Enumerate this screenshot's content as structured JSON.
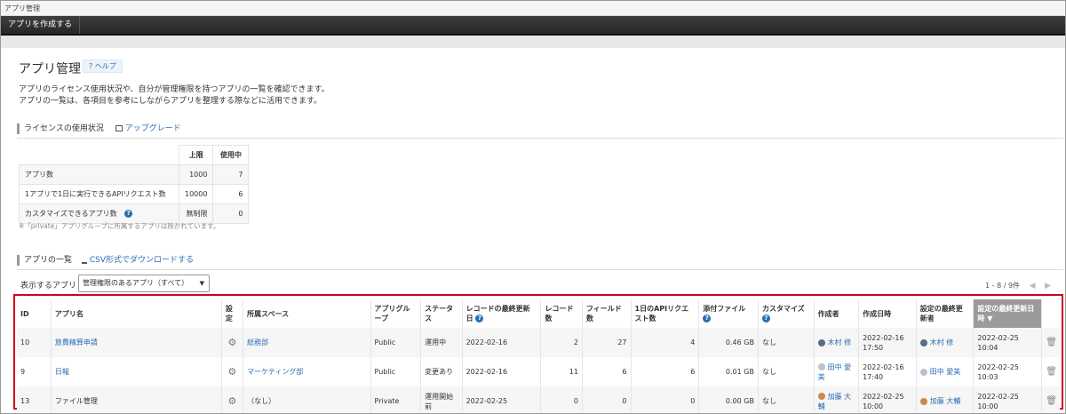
{
  "window": {
    "title": "アプリ管理"
  },
  "toolbar": {
    "create_label": "アプリを作成する"
  },
  "page": {
    "title": "アプリ管理",
    "help_label": "? ヘルプ",
    "desc_line1": "アプリのライセンス使用状況や、自分が管理権限を持つアプリの一覧を確認できます。",
    "desc_line2": "アプリの一覧は、各項目を参考にしながらアプリを整理する際などに活用できます。"
  },
  "license": {
    "heading": "ライセンスの使用状況",
    "upgrade_label": "アップグレード",
    "col_limit": "上限",
    "col_used": "使用中",
    "rows": [
      {
        "label": "アプリ数",
        "limit": "1000",
        "used": "7"
      },
      {
        "label": "1アプリで1日に実行できるAPIリクエスト数",
        "limit": "10000",
        "used": "6"
      },
      {
        "label": "カスタマイズできるアプリ数",
        "limit": "無制限",
        "used": "0"
      }
    ],
    "note": "※「private」アプリグループに所属するアプリは除かれています。"
  },
  "apps": {
    "heading": "アプリの一覧",
    "csv_label": "CSV形式でダウンロードする",
    "filter_label": "表示するアプリ",
    "filter_value": "管理権限のあるアプリ（すべて）",
    "paging": "1 - 8 / 9件",
    "columns": {
      "id": "ID",
      "name": "アプリ名",
      "settings": "設定",
      "space": "所属スペース",
      "group": "アプリグループ",
      "status": "ステータス",
      "last_record": "レコードの最終更新日",
      "records": "レコード数",
      "fields": "フィールド数",
      "api": "1日のAPIリクエスト数",
      "files": "添付ファイル",
      "custom": "カスタマイズ",
      "creator": "作成者",
      "created": "作成日時",
      "last_modifier": "設定の最終更新者",
      "last_modified": "設定の最終更新日時 ▼"
    },
    "rows": [
      {
        "id": "10",
        "name": "旅費精算申請",
        "space": "総務部",
        "group": "Public",
        "status": "運用中",
        "last_record": "2022-02-16",
        "records": "2",
        "fields": "27",
        "api": "4",
        "files": "0.46 GB",
        "custom": "なし",
        "creator": "木村 修",
        "created": "2022-02-16 17:50",
        "modifier": "木村 修",
        "modified": "2022-02-25 10:04"
      },
      {
        "id": "9",
        "name": "日報",
        "space": "マーケティング部",
        "group": "Public",
        "status": "変更あり",
        "last_record": "2022-02-16",
        "records": "11",
        "fields": "6",
        "api": "6",
        "files": "0.01 GB",
        "custom": "なし",
        "creator": "田中 愛美",
        "created": "2022-02-16 17:40",
        "modifier": "田中 愛美",
        "modified": "2022-02-25 10:03"
      },
      {
        "id": "13",
        "name": "ファイル管理",
        "space": "（なし）",
        "group": "Private",
        "status": "運用開始前",
        "last_record": "2022-02-25",
        "records": "0",
        "fields": "0",
        "api": "0",
        "files": "0.00 GB",
        "custom": "なし",
        "creator": "加藤 大輔",
        "created": "2022-02-25 10:00",
        "modifier": "加藤 大輔",
        "modified": "2022-02-25 10:00"
      }
    ]
  }
}
